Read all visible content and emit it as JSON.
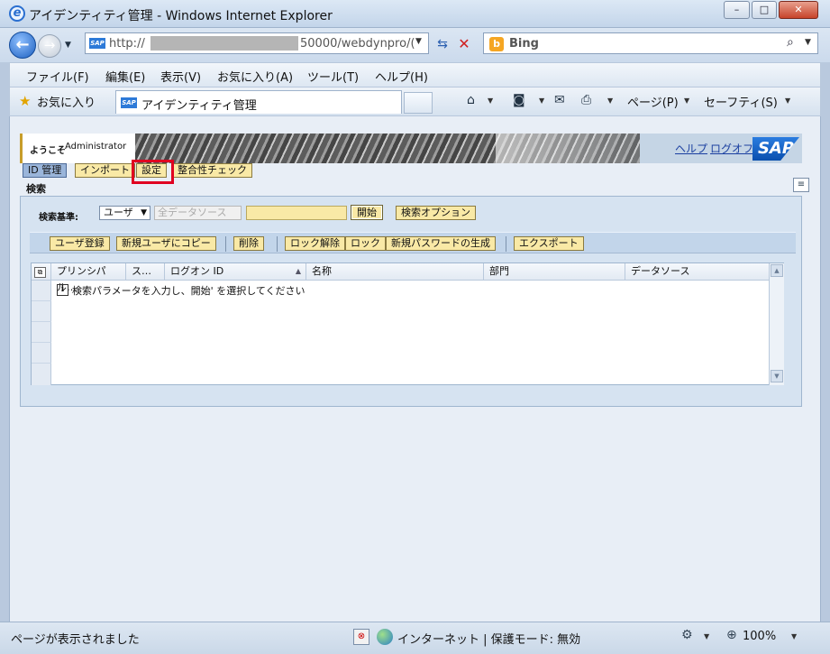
{
  "window": {
    "title": "アイデンティティ管理 - Windows Internet Explorer",
    "controls": {
      "minimize": "–",
      "maximize": "□",
      "close": "✕"
    }
  },
  "address": {
    "url_prefix": "http://",
    "url_suffix": "50000/webdynpro/(",
    "search_provider": "Bing"
  },
  "menu": [
    "ファイル(F)",
    "編集(E)",
    "表示(V)",
    "お気に入り(A)",
    "ツール(T)",
    "ヘルプ(H)"
  ],
  "favbar": {
    "favorites_label": "お気に入り",
    "tab_title": "アイデンティティ管理",
    "page_menu": "ページ(P)",
    "safety_menu": "セーフティ(S)"
  },
  "sap": {
    "welcome": "ようこそ",
    "user": "Administrator",
    "help_link": "ヘルプ",
    "logoff_link": "ログオフ",
    "logo": "SAP",
    "tabs": [
      "ID 管理",
      "インポート",
      "設定",
      "整合性チェック"
    ],
    "section_title": "検索",
    "search_label": "検索基準:",
    "search_type": "ユーザ",
    "datasource_placeholder": "全データソース",
    "search_value": "",
    "start_button": "開始",
    "search_options_button": "検索オプション",
    "toolbar": [
      "ユーザ登録",
      "新規ユーザにコピー",
      "削除",
      "ロック解除",
      "ロック",
      "新規パスワードの生成",
      "エクスポート"
    ],
    "table": {
      "columns": [
        "プリンシパル…",
        "ス…",
        "ログオン ID",
        "名称",
        "部門",
        "データソース"
      ],
      "sort_indicator": "▲",
      "info_message": "検索パラメータを入力し、開始' を選択してください"
    }
  },
  "status": {
    "text": "ページが表示されました",
    "zone": "インターネット | 保護モード: 無効",
    "zoom": "100%"
  }
}
